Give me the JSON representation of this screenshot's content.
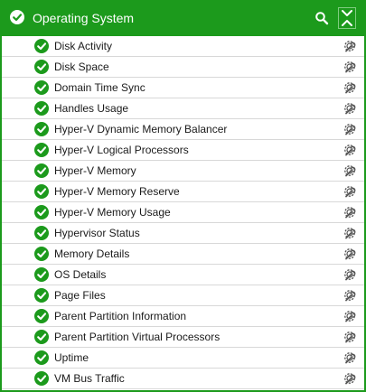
{
  "header": {
    "title": "Operating System",
    "status_icon": "check-circle-icon",
    "search_icon": "search-icon",
    "collapse_icon": "collapse-all-icon"
  },
  "colors": {
    "accent": "#1c9a1c",
    "ok": "#1c9a1c",
    "row_border": "#d8d8d8"
  },
  "items": [
    {
      "label": "Disk Activity",
      "status": "ok"
    },
    {
      "label": "Disk Space",
      "status": "ok"
    },
    {
      "label": "Domain Time Sync",
      "status": "ok"
    },
    {
      "label": "Handles Usage",
      "status": "ok"
    },
    {
      "label": "Hyper-V Dynamic Memory Balancer",
      "status": "ok"
    },
    {
      "label": "Hyper-V Logical Processors",
      "status": "ok"
    },
    {
      "label": "Hyper-V Memory",
      "status": "ok"
    },
    {
      "label": "Hyper-V Memory Reserve",
      "status": "ok"
    },
    {
      "label": "Hyper-V Memory Usage",
      "status": "ok"
    },
    {
      "label": "Hypervisor Status",
      "status": "ok"
    },
    {
      "label": "Memory Details",
      "status": "ok"
    },
    {
      "label": "OS Details",
      "status": "ok"
    },
    {
      "label": "Page Files",
      "status": "ok"
    },
    {
      "label": "Parent Partition Information",
      "status": "ok"
    },
    {
      "label": "Parent Partition Virtual Processors",
      "status": "ok"
    },
    {
      "label": "Uptime",
      "status": "ok"
    },
    {
      "label": "VM Bus Traffic",
      "status": "ok"
    }
  ]
}
